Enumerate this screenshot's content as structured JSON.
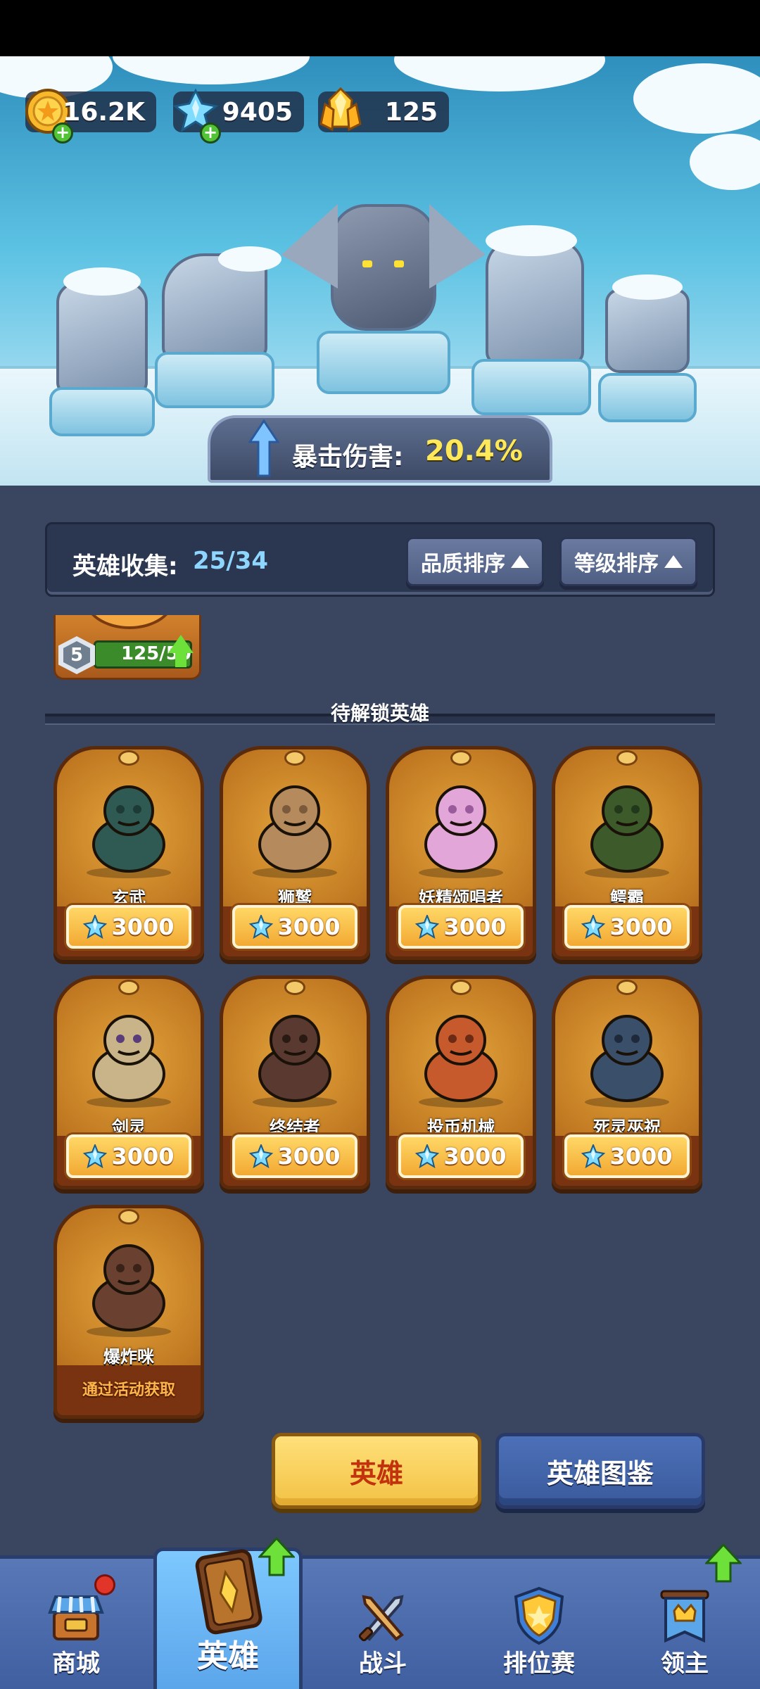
{
  "currencies": [
    {
      "name": "gold",
      "value": "16.2K",
      "icon": "gold-coin-icon",
      "has_plus": true
    },
    {
      "name": "crystal",
      "value": "9405",
      "icon": "blue-crystal-icon",
      "has_plus": true
    },
    {
      "name": "gem",
      "value": "125",
      "icon": "gold-gem-icon",
      "has_plus": false
    }
  ],
  "stat": {
    "label": "暴击伤害:",
    "value": "20.4%"
  },
  "collection": {
    "label": "英雄收集:",
    "value": "25/34"
  },
  "sort_buttons": [
    {
      "label": "品质排序",
      "icon": "sort-up-icon"
    },
    {
      "label": "等级排序",
      "icon": "sort-up-icon"
    }
  ],
  "owned_card_partial": {
    "level": "5",
    "shards": "125/50"
  },
  "locked_section_title": "待解锁英雄",
  "locked_heroes": [
    {
      "name": "玄武",
      "price": "3000"
    },
    {
      "name": "狮鹫",
      "price": "3000"
    },
    {
      "name": "妖精颂唱者",
      "price": "3000"
    },
    {
      "name": "鳄霸",
      "price": "3000"
    },
    {
      "name": "剑灵",
      "price": "3000"
    },
    {
      "name": "终结者",
      "price": "3000"
    },
    {
      "name": "投币机械",
      "price": "3000"
    },
    {
      "name": "死灵巫祝",
      "price": "3000"
    },
    {
      "name": "爆炸咪",
      "event_label": "通过活动获取"
    }
  ],
  "bottom_buttons": {
    "heroes": "英雄",
    "codex": "英雄图鉴"
  },
  "nav": [
    {
      "label": "商城",
      "icon": "shop-icon",
      "badge": "red-dot"
    },
    {
      "label": "英雄",
      "icon": "hero-card-icon",
      "badge": "upgrade-arrow",
      "active": true
    },
    {
      "label": "战斗",
      "icon": "crossed-swords-icon"
    },
    {
      "label": "排位赛",
      "icon": "ranked-shield-icon"
    },
    {
      "label": "领主",
      "icon": "lord-banner-icon",
      "badge": "upgrade-arrow"
    }
  ],
  "colors": {
    "accent_yellow": "#ffe95b",
    "crystal_blue": "#8ed6ff",
    "panel": "#3a4660",
    "nav": "#4f6fb0"
  }
}
